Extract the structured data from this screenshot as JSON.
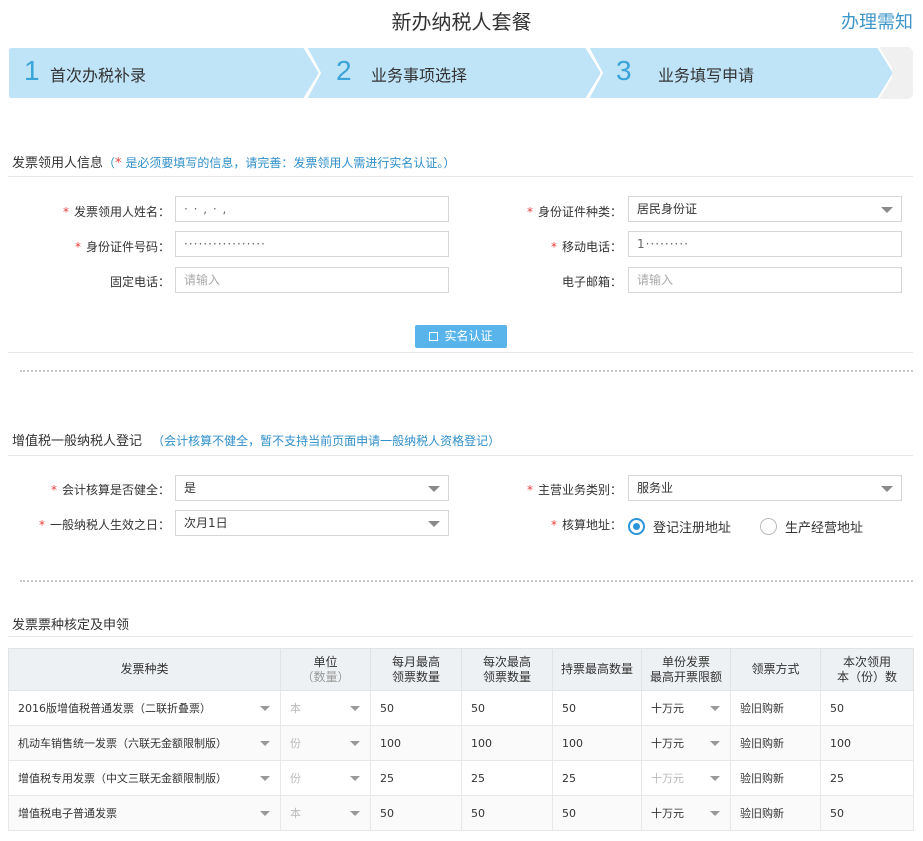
{
  "header": {
    "title": "新办纳税人套餐",
    "notice_link": "办理需知"
  },
  "steps": [
    {
      "num": "1",
      "label": "首次办税补录"
    },
    {
      "num": "2",
      "label": "业务事项选择"
    },
    {
      "num": "3",
      "label": "业务填写申请"
    }
  ],
  "invoice_user": {
    "title": "发票领用人信息",
    "note_open": "（",
    "note_star": "*",
    "note_text": " 是必须要填写的信息，请完善：发票领用人需进行实名认证。）",
    "fields": {
      "name_label": "发票领用人姓名：",
      "name_value": "· · , · ,",
      "id_type_label": "身份证件种类：",
      "id_type_value": "居民身份证",
      "id_number_label": "身份证件号码：",
      "id_number_value": "·················",
      "mobile_label": "移动电话：",
      "mobile_value": "1·········",
      "phone_label": "固定电话：",
      "phone_placeholder": "请输入",
      "email_label": "电子邮箱：",
      "email_placeholder": "请输入"
    },
    "verify_button": "实名认证"
  },
  "vat_register": {
    "title": "增值税一般纳税人登记",
    "note": "（会计核算不健全，暂不支持当前页面申请一般纳税人资格登记）",
    "fields": {
      "accounting_label": "会计核算是否健全：",
      "accounting_value": "是",
      "business_label": "主营业务类别：",
      "business_value": "服务业",
      "effective_label": "一般纳税人生效之日：",
      "effective_value": "次月1日",
      "address_label": "核算地址：",
      "address_options": [
        "登记注册地址",
        "生产经营地址"
      ],
      "address_selected": "登记注册地址"
    }
  },
  "invoice_types": {
    "title": "发票票种核定及申领",
    "headers": {
      "type": "发票种类",
      "unit_1": "单位",
      "unit_2": "（数量）",
      "monthly_1": "每月最高",
      "monthly_2": "领票数量",
      "each_1": "每次最高",
      "each_2": "领票数量",
      "hold": "持票最高数量",
      "limit_1": "单份发票",
      "limit_2": "最高开票限额",
      "method": "领票方式",
      "current_1": "本次领用",
      "current_2": "本（份）数"
    },
    "rows": [
      {
        "type": "2016版增值税普通发票（二联折叠票）",
        "unit": "本",
        "monthly": "50",
        "each": "50",
        "hold": "50",
        "limit": "十万元",
        "method": "验旧购新",
        "current": "50"
      },
      {
        "type": "机动车销售统一发票（六联无金额限制版）",
        "unit": "份",
        "monthly": "100",
        "each": "100",
        "hold": "100",
        "limit": "十万元",
        "method": "验旧购新",
        "current": "100"
      },
      {
        "type": "增值税专用发票（中文三联无金额限制版）",
        "unit": "份",
        "monthly": "25",
        "each": "25",
        "hold": "25",
        "limit": "十万元",
        "method": "验旧购新",
        "current": "25"
      },
      {
        "type": "增值税电子普通发票",
        "unit": "本",
        "monthly": "50",
        "each": "50",
        "hold": "50",
        "limit": "十万元",
        "method": "验旧购新",
        "current": "50"
      }
    ]
  }
}
